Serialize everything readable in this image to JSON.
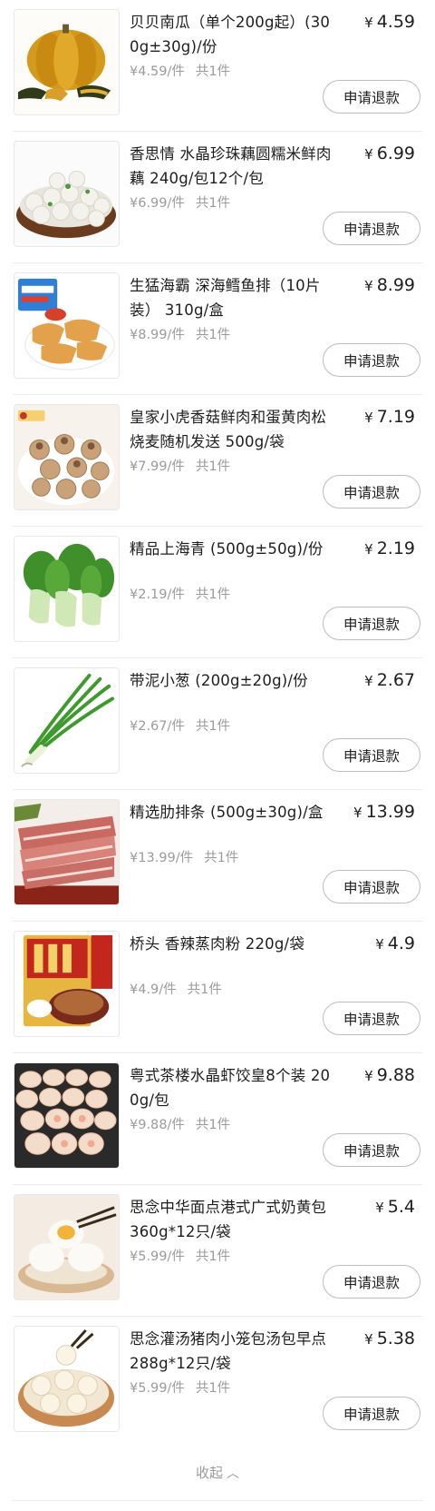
{
  "items": [
    {
      "name": "贝贝南瓜（单个200g起）(300g±30g)/份",
      "price": "4.59",
      "unit_price": "¥4.59/件",
      "qty": "共1件",
      "refund_label": "申请退款",
      "icon": "pumpkin-image"
    },
    {
      "name": "香思情 水晶珍珠藕圆糯米鲜肉藕 240g/包12个/包",
      "price": "6.99",
      "unit_price": "¥6.99/件",
      "qty": "共1件",
      "refund_label": "申请退款",
      "icon": "lotus-root-balls-image"
    },
    {
      "name": "生猛海霸 深海鳕鱼排（10片装） 310g/盒",
      "price": "8.99",
      "unit_price": "¥8.99/件",
      "qty": "共1件",
      "refund_label": "申请退款",
      "icon": "fish-fillet-image"
    },
    {
      "name": "皇家小虎香菇鲜肉和蛋黄肉松烧麦随机发送 500g/袋",
      "price": "7.19",
      "unit_price": "¥7.99/件",
      "qty": "共1件",
      "refund_label": "申请退款",
      "icon": "shaomai-image"
    },
    {
      "name": "精品上海青 (500g±50g)/份",
      "price": "2.19",
      "unit_price": "¥2.19/件",
      "qty": "共1件",
      "refund_label": "申请退款",
      "icon": "bok-choy-image"
    },
    {
      "name": "带泥小葱 (200g±20g)/份",
      "price": "2.67",
      "unit_price": "¥2.67/件",
      "qty": "共1件",
      "refund_label": "申请退款",
      "icon": "scallion-image"
    },
    {
      "name": "精选肋排条 (500g±30g)/盒",
      "price": "13.99",
      "unit_price": "¥13.99/件",
      "qty": "共1件",
      "refund_label": "申请退款",
      "icon": "pork-ribs-image"
    },
    {
      "name": "桥头 香辣蒸肉粉 220g/袋",
      "price": "4.9",
      "unit_price": "¥4.9/件",
      "qty": "共1件",
      "refund_label": "申请退款",
      "icon": "steamed-meat-powder-image"
    },
    {
      "name": "粤式茶楼水晶虾饺皇8个装 200g/包",
      "price": "9.88",
      "unit_price": "¥9.88/件",
      "qty": "共1件",
      "refund_label": "申请退款",
      "icon": "shrimp-dumpling-image"
    },
    {
      "name": "思念中华面点港式广式奶黄包 360g*12只/袋",
      "price": "5.4",
      "unit_price": "¥5.99/件",
      "qty": "共1件",
      "refund_label": "申请退款",
      "icon": "custard-bun-image"
    },
    {
      "name": "思念灌汤猪肉小笼包汤包早点 288g*12只/袋",
      "price": "5.38",
      "unit_price": "¥5.99/件",
      "qty": "共1件",
      "refund_label": "申请退款",
      "icon": "xiaolongbao-image"
    }
  ],
  "currency_symbol": "¥",
  "collapse_label": "收起",
  "collapse_icon": "chevron-up-icon",
  "colors": {
    "text": "#1e1e1e",
    "muted": "#9b9b9b",
    "border": "#bdbdbd"
  }
}
